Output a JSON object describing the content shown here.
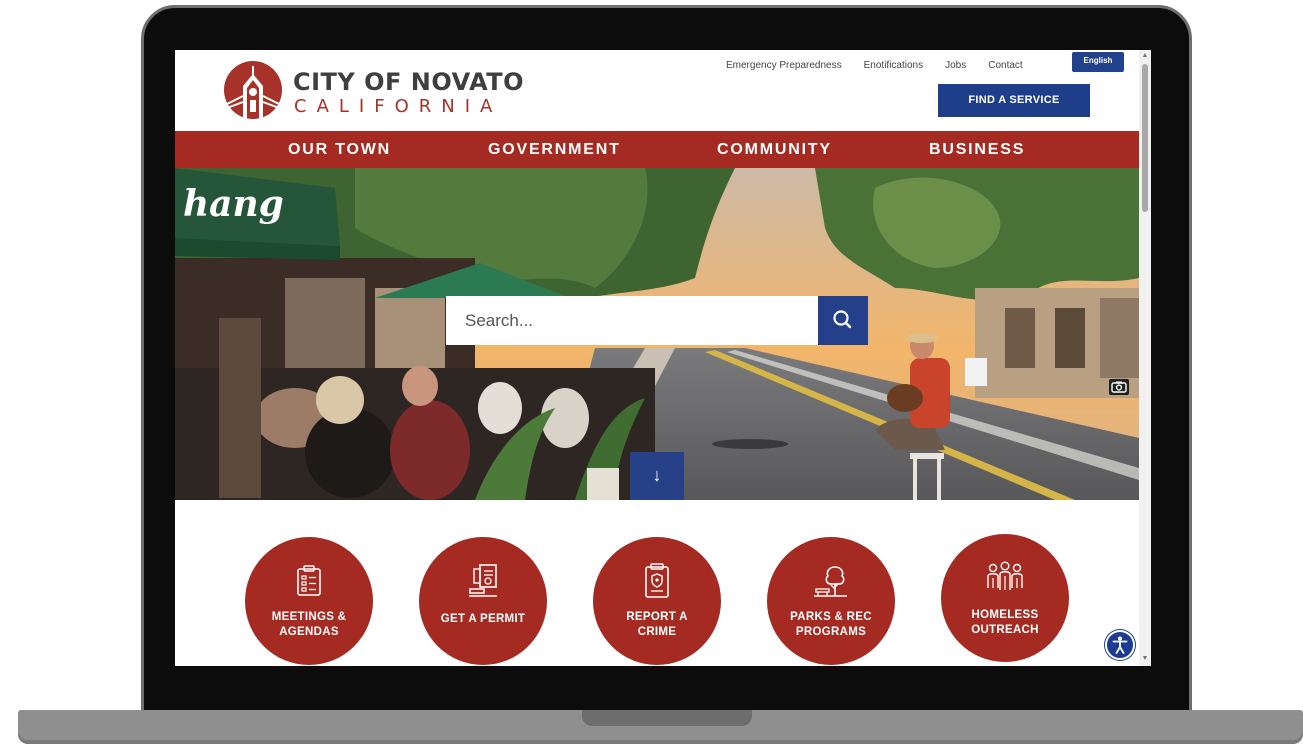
{
  "header": {
    "logo": {
      "line1": "CITY OF NOVATO",
      "line2": "CALIFORNIA"
    },
    "utility_links": [
      "Emergency Preparedness",
      "Enotifications",
      "Jobs",
      "Contact"
    ],
    "language_button": "English",
    "find_service_button": "FIND A SERVICE"
  },
  "nav": {
    "items": [
      "OUR TOWN",
      "GOVERNMENT",
      "COMMUNITY",
      "BUSINESS"
    ]
  },
  "hero": {
    "umbrella_text": "hang",
    "search": {
      "placeholder": "Search...",
      "value": ""
    }
  },
  "quick_links": [
    {
      "label": "MEETINGS &\nAGENDAS",
      "icon": "clipboard-list-icon"
    },
    {
      "label": "GET A PERMIT",
      "icon": "permit-stamp-icon"
    },
    {
      "label": "REPORT A\nCRIME",
      "icon": "police-badge-icon"
    },
    {
      "label": "PARKS & REC\nPROGRAMS",
      "icon": "tree-bench-icon"
    },
    {
      "label": "HOMELESS\nOUTREACH",
      "icon": "people-group-icon"
    }
  ],
  "colors": {
    "brand_red": "#a52a22",
    "brand_blue": "#1f3e8a",
    "text_dark": "#3f3f3f"
  }
}
